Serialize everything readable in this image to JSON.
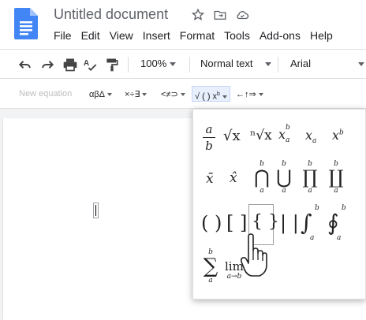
{
  "document": {
    "title": "Untitled document",
    "menu": [
      "File",
      "Edit",
      "View",
      "Insert",
      "Format",
      "Tools",
      "Add-ons",
      "Help"
    ]
  },
  "toolbar": {
    "zoom": "100%",
    "style": "Normal text",
    "font": "Arial"
  },
  "equation_bar": {
    "new_equation": "New equation",
    "groups": [
      "αβΔ",
      "×÷∃",
      "<≠⊃",
      "√ ( ) x",
      "←↑⇒"
    ]
  },
  "math_palette": {
    "fraction": {
      "num": "a",
      "den": "b"
    },
    "sqrt": "√x",
    "nthroot": "ⁿ√x",
    "subsup": {
      "base": "x",
      "sup": "b",
      "sub": "a"
    },
    "sub": {
      "base": "x",
      "sub": "a"
    },
    "sup": {
      "base": "x",
      "sup": "b"
    },
    "overbar": "x̄",
    "hat": "x̂",
    "cap": {
      "sym": "⋂",
      "sup": "b",
      "sub": "a"
    },
    "cup": {
      "sym": "⋃",
      "sup": "b",
      "sub": "a"
    },
    "prod": {
      "sym": "∏",
      "sup": "b",
      "sub": "a"
    },
    "coprod": {
      "sym": "∐",
      "sup": "b",
      "sub": "a"
    },
    "parens": "( )",
    "brackets": "[ ]",
    "braces": "{ }",
    "bars": "| |",
    "integral": {
      "sym": "∫",
      "sup": "b",
      "sub": "a"
    },
    "contour": {
      "sym": "∮",
      "sup": "b",
      "sub": "a"
    },
    "sum": {
      "sym": "∑",
      "sup": "b",
      "sub": "a"
    },
    "limit": {
      "word": "lim",
      "sub": "a→b"
    }
  }
}
